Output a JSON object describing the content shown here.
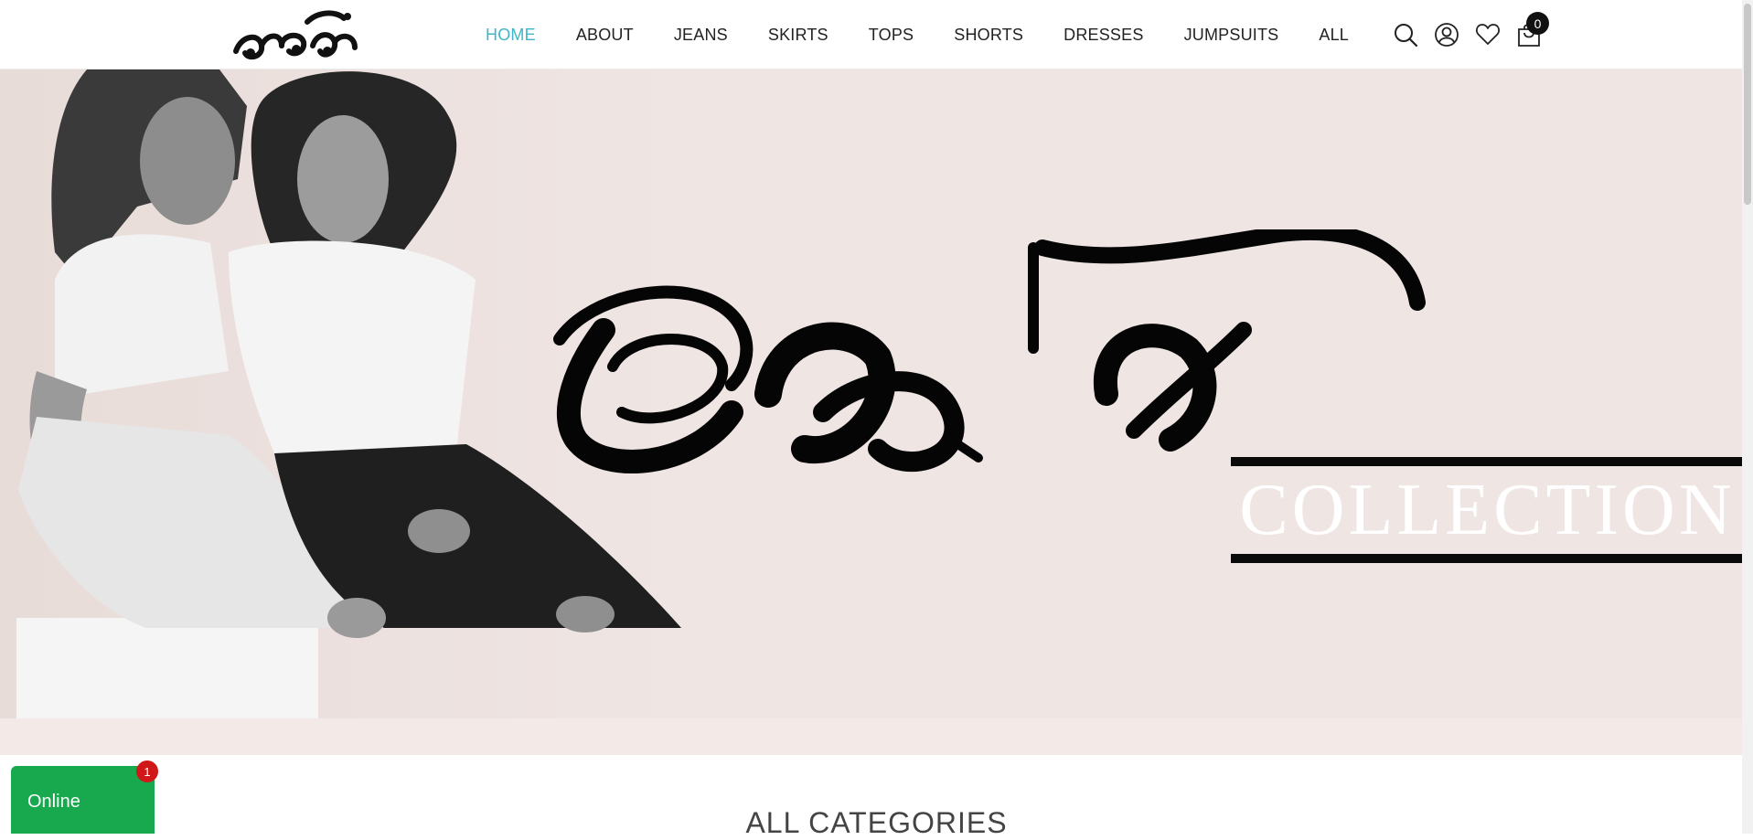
{
  "header": {
    "logo_text": "සමීප",
    "nav": [
      {
        "label": "HOME",
        "active": true
      },
      {
        "label": "ABOUT"
      },
      {
        "label": "JEANS"
      },
      {
        "label": "SKIRTS"
      },
      {
        "label": "TOPS"
      },
      {
        "label": "SHORTS"
      },
      {
        "label": "DRESSES"
      },
      {
        "label": "JUMPSUITS"
      },
      {
        "label": "ALL"
      }
    ],
    "icons": [
      "search-icon",
      "user-icon",
      "heart-icon",
      "cart-icon"
    ],
    "cart_count": "0"
  },
  "hero": {
    "script_text": "මිශ්‍ර",
    "collection_label": "COLLECTION",
    "background_color": "#efe5e3"
  },
  "section": {
    "title": "ALL CATEGORIES"
  },
  "chat": {
    "label": "Online",
    "badge": "1",
    "color": "#18a94e"
  },
  "colors": {
    "accent_active_nav": "#3fb6c9",
    "badge_red": "#d01818"
  }
}
